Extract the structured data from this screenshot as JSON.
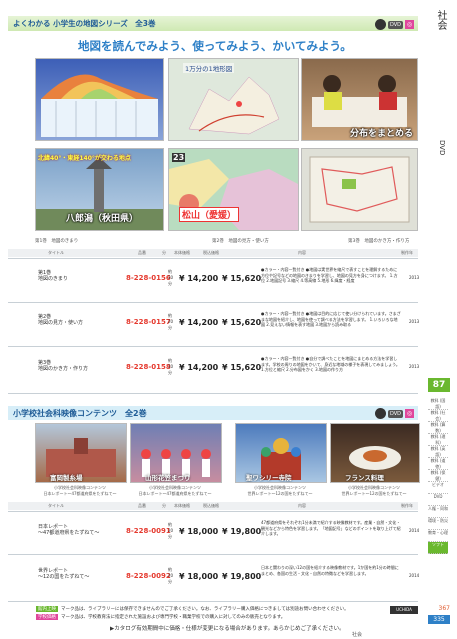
{
  "sidebar": {
    "category": "社会",
    "media": "DVD",
    "page": "87",
    "tabs": [
      "教科 (国語)",
      "教科 (社会)",
      "教科 (算数)",
      "教科 (理科)",
      "教科 (英語)",
      "教科 (道徳)",
      "教科 (保健)",
      "ビデオ",
      "DVD",
      "人権・同和",
      "環境・防災",
      "教育・心理",
      "ソフト"
    ]
  },
  "series1": {
    "heading": "よくわかる 小学生の地図シリーズ　全3巻",
    "subtitle": "地図を読んでみよう、使ってみよう、かいてみよう。",
    "images": [
      {
        "caption": "第1巻　地図のきまり",
        "overlay": ""
      },
      {
        "caption": "第1巻　地図のきまり",
        "overlay": "1万分の1地形図"
      },
      {
        "caption": "",
        "overlay": "分布をまとめる"
      },
      {
        "caption": "第1巻　地図のきまり",
        "overlay": "八郎潟（秋田県）"
      },
      {
        "caption": "第2巻　地図の見方・使い方",
        "overlay": "松山（愛媛）"
      },
      {
        "caption": "第3巻　地図のかき方・作り方",
        "overlay": ""
      }
    ],
    "rows": [
      {
        "name": "第1巻\n地図のきまり",
        "code": "8-228-0156",
        "min": "約20分",
        "price": "¥ 14,200",
        "price_tax": "¥ 15,620",
        "year": "2013",
        "desc": "●カラー・内容一覧付き ●地図は実世界を縮尺で表すことを理解するために方位や記号などの地図のきまりを学習し、地図の見方を身につけます。 1.方位 2.地図記号 3.縮尺 4.等高線 5.地形 6.緯度・経度"
      },
      {
        "name": "第2巻\n地図の見方・使い方",
        "code": "8-228-0157",
        "min": "約20分",
        "price": "¥ 14,200",
        "price_tax": "¥ 15,620",
        "year": "2013",
        "desc": "●カラー・内容一覧付き ●地図は目的に応じて使い分けられています。さまざまな地図を紹介し、地図を使って調べる方法を学習します。 1.いろいろな地図 2.見えない情報を表す地図 3.地図から読み取る"
      },
      {
        "name": "第3巻\n地図のかき方・作り方",
        "code": "8-228-0158",
        "min": "約20分",
        "price": "¥ 14,200",
        "price_tax": "¥ 15,620",
        "year": "2013",
        "desc": "●カラー・内容一覧付き ●自分で調べたことを地図にまとめる方法を学習します。学校の周りの地図をかいて、身近な地域の様子を表現してみましょう。 1.方位と縮尺 2.分布図をかく 3.地図の作り方"
      }
    ]
  },
  "series2": {
    "heading": "小学校社会科映像コンテンツ　全2巻",
    "images": [
      {
        "caption": "小学校社会科映像コンテンツ\n日本レポート〜47都道府県をたずねて〜",
        "overlay": "富岡製糸場"
      },
      {
        "caption": "小学校社会科映像コンテンツ\n日本レポート〜47都道府県をたずねて〜",
        "overlay": "山形花笠まつり"
      },
      {
        "caption": "小学校社会科映像コンテンツ\n世界レポート〜12の国をたずねて〜",
        "overlay": "聖ワシリー寺院"
      },
      {
        "caption": "小学校社会科映像コンテンツ\n世界レポート〜12の国をたずねて〜",
        "overlay": "フランス料理"
      }
    ],
    "rows": [
      {
        "name": "日本レポート\n〜47都道府県をたずねて〜",
        "code": "8-228-0091",
        "min": "約20分",
        "price": "¥ 18,000",
        "price_tax": "¥ 19,800",
        "year": "2014",
        "desc": "47都道府県をそれぞれ1分未満で紹介する映像教材です。産業・自然・文化・観光などから特色を学習します。「地図記号」などのポイントを取り上げて紹介します。"
      },
      {
        "name": "世界レポート\n〜12の国をたずねて〜",
        "code": "8-228-0092",
        "min": "約20分",
        "price": "¥ 18,000",
        "price_tax": "¥ 19,800",
        "year": "2014",
        "desc": "日本と関わりの深い12の国を紹介する映像教材です。1か国を約1分の時間にまとめ、各国の生活・文化・自然の特徴などを学習します。"
      }
    ]
  },
  "footer": {
    "note1": "マーク品は、ライブラリーには保存できませんのでご了承ください。なお、ライブラリー購入価格につきましては別途お問い合わせください。",
    "note2": "マーク品は、学校教育法に指定された施設および専門学校・職業学校での購入に対してのみの販売となります。",
    "note3": "▶カタログ有効期間中に価格・仕様が変更になる場合があります。あらかじめご了承ください。",
    "badge1": "館内上映",
    "badge2": "学校価格",
    "brand": "UCHIDA",
    "page_a": "367",
    "page_b": "335",
    "page_label": "社会"
  },
  "table_headers": [
    "タイトル",
    "品番",
    "分",
    "本体価格",
    "税込価格",
    "内容",
    "制作年"
  ],
  "colors": {
    "accent": "#6ab82f",
    "code": "#e53a2f",
    "tab": "#6ab82f"
  }
}
